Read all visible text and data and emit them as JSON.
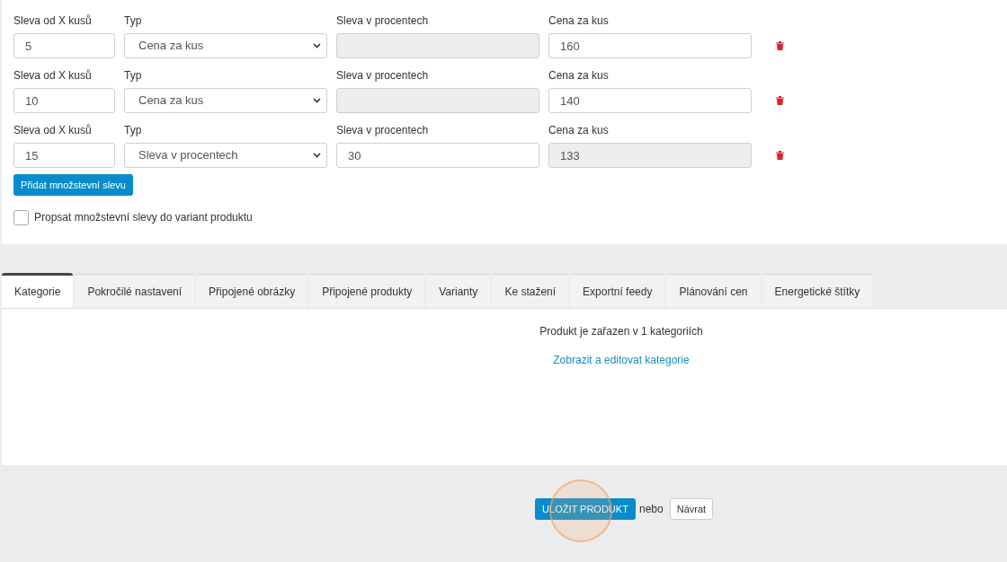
{
  "discounts": [
    {
      "qty_label": "Sleva od X kusů",
      "qty": "5",
      "type_label": "Typ",
      "type": "Cena za kus",
      "percent_label": "Sleva v procentech",
      "percent_disabled": true,
      "price_label": "Cena za kus",
      "price": "160",
      "price_disabled": false
    },
    {
      "qty_label": "Sleva od X kusů",
      "qty": "10",
      "type_label": "Typ",
      "type": "Cena za kus",
      "percent_label": "Sleva v procentech",
      "percent_disabled": true,
      "price_label": "Cena za kus",
      "price": "140",
      "price_disabled": false
    },
    {
      "qty_label": "Sleva od X kusů",
      "qty": "15",
      "type_label": "Typ",
      "type": "Sleva v procentech",
      "percent_label": "Sleva v procentech",
      "percent": "30",
      "percent_disabled": false,
      "price_label": "Cena za kus",
      "price": "133",
      "price_disabled": true
    }
  ],
  "add_button": "Přidat množstevní slevu",
  "propagate": {
    "label": "Propsat množstevní slevy do variant produktu",
    "checked": false
  },
  "tabs": [
    {
      "label": "Kategorie",
      "selected": true
    },
    {
      "label": "Pokročilé nastavení",
      "selected": false
    },
    {
      "label": "Připojené obrázky",
      "selected": false
    },
    {
      "label": "Připojené produkty",
      "selected": false
    },
    {
      "label": "Varianty",
      "selected": false
    },
    {
      "label": "Ke stažení",
      "selected": false
    },
    {
      "label": "Exportní feedy",
      "selected": false
    },
    {
      "label": "Plánování cen",
      "selected": false
    },
    {
      "label": "Energetické štítky",
      "selected": false
    }
  ],
  "tab_content": {
    "text": "Produkt je zařazen v 1 kategoriích",
    "link": "Zobrazit a editovat kategorie"
  },
  "footer": {
    "save": "ULOŽIT PRODUKT",
    "or": "nebo",
    "back": "Návrat"
  }
}
